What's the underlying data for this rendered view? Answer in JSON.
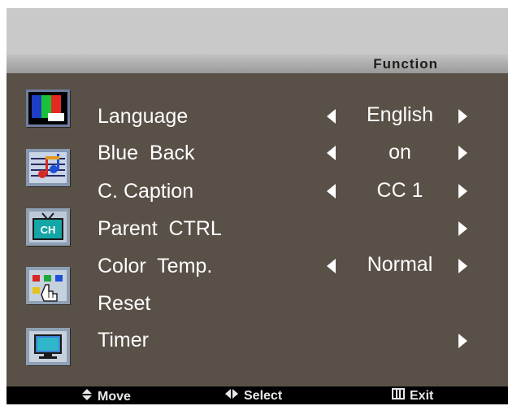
{
  "header": {
    "title": "Function"
  },
  "menu": [
    {
      "label": "Language",
      "value": "English",
      "has_left": true,
      "has_right": true
    },
    {
      "label": "Blue  Back",
      "value": "on",
      "has_left": true,
      "has_right": true
    },
    {
      "label": "C. Caption",
      "value": "CC 1",
      "has_left": true,
      "has_right": true
    },
    {
      "label": "Parent  CTRL",
      "value": "",
      "has_left": false,
      "has_right": true
    },
    {
      "label": "Color  Temp.",
      "value": "Normal",
      "has_left": true,
      "has_right": true
    },
    {
      "label": "Reset",
      "value": "",
      "has_left": false,
      "has_right": false
    },
    {
      "label": "Timer",
      "value": "",
      "has_left": false,
      "has_right": true
    }
  ],
  "icons": [
    "picture-icon",
    "sound-icon",
    "channel-icon",
    "function-icon",
    "screen-icon"
  ],
  "channel_icon_text": "CH",
  "footer": {
    "move": "Move",
    "select": "Select",
    "exit": "Exit"
  },
  "colors": {
    "background": "#595047",
    "header": "#b0b0b0",
    "text": "#ffffff",
    "footer": "#000000"
  }
}
